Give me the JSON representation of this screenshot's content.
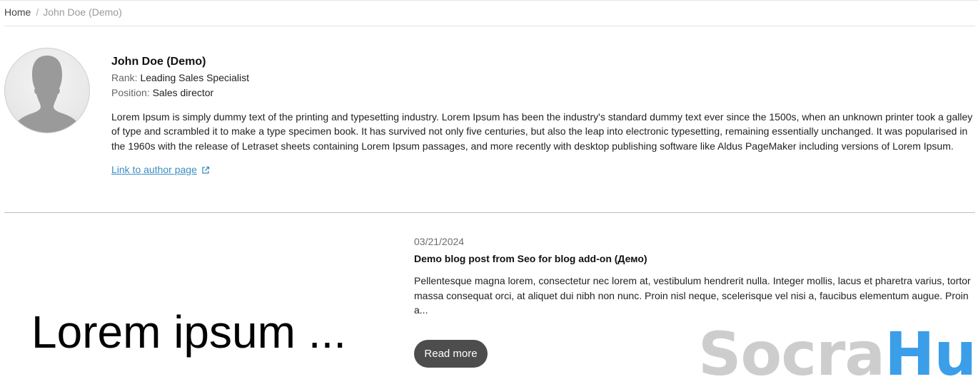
{
  "breadcrumb": {
    "home": "Home",
    "separator": "/",
    "current": "John Doe (Demo)"
  },
  "author": {
    "avatar_icon": "user-silhouette-icon",
    "name": "John Doe (Demo)",
    "rank_label": "Rank:",
    "rank_value": "Leading Sales Specialist",
    "position_label": "Position:",
    "position_value": "Sales director",
    "bio": "Lorem Ipsum is simply dummy text of the printing and typesetting industry. Lorem Ipsum has been the industry's standard dummy text ever since the 1500s, when an unknown printer took a galley of type and scrambled it to make a type specimen book. It has survived not only five centuries, but also the leap into electronic typesetting, remaining essentially unchanged. It was popularised in the 1960s with the release of Letraset sheets containing Lorem Ipsum passages, and more recently with desktop publishing software like Aldus PageMaker including versions of Lorem Ipsum.",
    "link_text": "Link to author page",
    "link_icon": "external-link-icon"
  },
  "post": {
    "image_text": "Lorem ipsum ...",
    "date": "03/21/2024",
    "title": "Demo blog post from Seo for blog add-on (Демо)",
    "excerpt": "Pellentesque magna lorem, consectetur nec lorem at, vestibulum hendrerit nulla. Integer mollis, lacus et pharetra varius, tortor massa consequat orci, at aliquet dui nibh non nunc. Proin nisl neque, scelerisque vel nisi a, faucibus elementum augue. Proin a...",
    "read_more": "Read more"
  },
  "watermark": {
    "part1": "Socra",
    "part2": "Hub",
    "color1": "#cdcdcd",
    "color2": "#3b9ee8"
  },
  "colors": {
    "link": "#3b8ec2",
    "button_bg": "#4d4d4d"
  }
}
